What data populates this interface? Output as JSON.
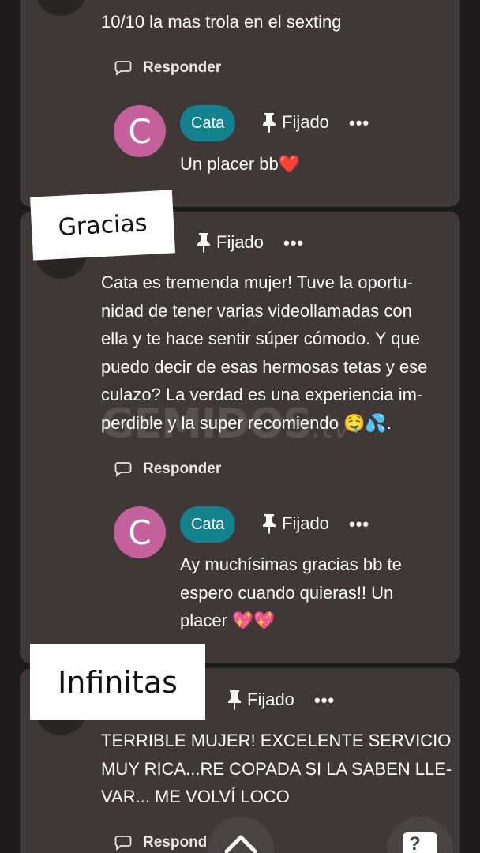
{
  "comments": [
    {
      "text": "10/10 la mas trola en el sexting",
      "reply_label": "Responder",
      "reply": {
        "avatar_letter": "C",
        "author": "Cata",
        "pinned_label": "Fijado",
        "more": "•••",
        "text": "Un placer bb❤️"
      }
    },
    {
      "pinned_label": "Fijado",
      "more": "•••",
      "text_lines": [
        "Cata es tremenda mujer! Tuve la oportu-",
        "nidad de tener varias videollamadas con",
        "ella y te hace sentir súper cómodo. Y que",
        "puedo decir de esas hermosas tetas y ese",
        "culazo? La verdad es una experiencia im-",
        "perdible y la super recomiendo 🤤💦."
      ],
      "reply_label": "Responder",
      "reply": {
        "avatar_letter": "C",
        "author": "Cata",
        "pinned_label": "Fijado",
        "more": "•••",
        "text_lines": [
          "Ay muchísimas gracias bb te",
          "espero cuando quieras!! Un",
          "placer 💖💖"
        ]
      }
    },
    {
      "pinned_label": "Fijado",
      "more": "•••",
      "text_lines": [
        "TERRIBLE MUJER! EXCELENTE SERVICIO",
        "MUY RICA...RE COPADA SI LA SABEN LLE-",
        "VAR... ME VOLVÍ LOCO"
      ],
      "reply_label": "Respond"
    }
  ],
  "stickers": {
    "gracias": "Gracias",
    "infinitas": "Infinitas"
  },
  "watermark": {
    "brand": "GEMIDOS",
    "suffix": ".tv"
  },
  "floating": {
    "help_label": "?"
  },
  "colors": {
    "card_bg": "#3f3837",
    "author_badge": "#13828e",
    "avatar": "#c4619c"
  },
  "icons": [
    "comment-icon",
    "pin-icon",
    "more-icon",
    "chevron-up-icon",
    "help-icon"
  ]
}
